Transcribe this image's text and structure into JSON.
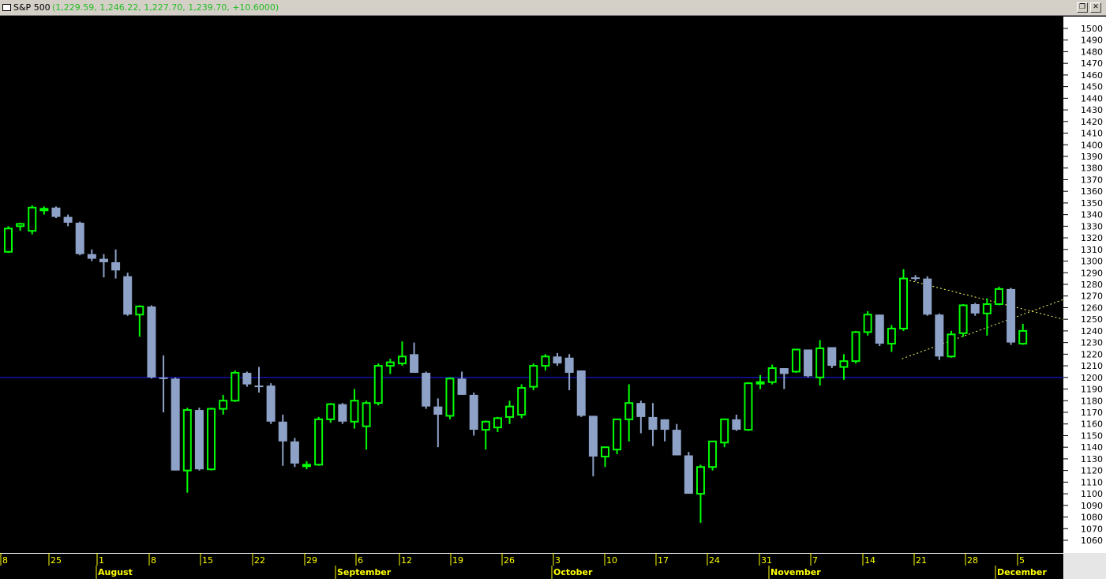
{
  "window": {
    "symbol": "S&P 500",
    "ohlc_readout": "(1,229.59, 1,246.22, 1,227.70, 1,239.70, +10.6000)",
    "restore_icon": "restore-window-icon",
    "close_icon": "close-window-icon",
    "restore_glyph": "❐",
    "close_glyph": "✕"
  },
  "colors": {
    "background": "#000000",
    "up_candle": "#00ff00",
    "down_candle": "#8ea2c8",
    "axis_text": "#ffff00",
    "horizontal_line": "#1a1aff",
    "trendline": "#ffff66"
  },
  "chart_data": {
    "type": "candlestick",
    "title": "S&P 500",
    "ylim": [
      1050,
      1510
    ],
    "y_ticks": [
      1060,
      1070,
      1080,
      1090,
      1100,
      1110,
      1120,
      1130,
      1140,
      1150,
      1160,
      1170,
      1180,
      1190,
      1200,
      1210,
      1220,
      1230,
      1240,
      1250,
      1260,
      1270,
      1280,
      1290,
      1300,
      1310,
      1320,
      1330,
      1340,
      1350,
      1360,
      1370,
      1380,
      1390,
      1400,
      1410,
      1420,
      1430,
      1440,
      1450,
      1460,
      1470,
      1480,
      1490,
      1500
    ],
    "x_day_ticks": [
      "8",
      "25",
      "1",
      "8",
      "15",
      "22",
      "29",
      "6",
      "12",
      "19",
      "26",
      "3",
      "10",
      "17",
      "24",
      "31",
      "7",
      "14",
      "21",
      "28",
      "5"
    ],
    "x_month_labels": [
      "August",
      "September",
      "October",
      "November",
      "December"
    ],
    "candles": [
      {
        "o": 1308,
        "h": 1330,
        "l": 1307,
        "c": 1328
      },
      {
        "o": 1330,
        "h": 1333,
        "l": 1326,
        "c": 1332
      },
      {
        "o": 1326,
        "h": 1348,
        "l": 1323,
        "c": 1346
      },
      {
        "o": 1344,
        "h": 1347,
        "l": 1340,
        "c": 1345
      },
      {
        "o": 1346,
        "h": 1347,
        "l": 1337,
        "c": 1338
      },
      {
        "o": 1338,
        "h": 1340,
        "l": 1330,
        "c": 1333
      },
      {
        "o": 1333,
        "h": 1334,
        "l": 1305,
        "c": 1306
      },
      {
        "o": 1306,
        "h": 1310,
        "l": 1300,
        "c": 1302
      },
      {
        "o": 1302,
        "h": 1306,
        "l": 1286,
        "c": 1299
      },
      {
        "o": 1299,
        "h": 1310,
        "l": 1285,
        "c": 1292
      },
      {
        "o": 1287,
        "h": 1290,
        "l": 1253,
        "c": 1254
      },
      {
        "o": 1254,
        "h": 1262,
        "l": 1235,
        "c": 1261
      },
      {
        "o": 1261,
        "h": 1262,
        "l": 1199,
        "c": 1200
      },
      {
        "o": 1200,
        "h": 1219,
        "l": 1170,
        "c": 1199
      },
      {
        "o": 1199,
        "h": 1200,
        "l": 1120,
        "c": 1120
      },
      {
        "o": 1120,
        "h": 1174,
        "l": 1101,
        "c": 1172
      },
      {
        "o": 1172,
        "h": 1174,
        "l": 1120,
        "c": 1121
      },
      {
        "o": 1121,
        "h": 1174,
        "l": 1120,
        "c": 1173
      },
      {
        "o": 1173,
        "h": 1185,
        "l": 1168,
        "c": 1180
      },
      {
        "o": 1180,
        "h": 1206,
        "l": 1179,
        "c": 1204
      },
      {
        "o": 1204,
        "h": 1205,
        "l": 1192,
        "c": 1194
      },
      {
        "o": 1193,
        "h": 1209,
        "l": 1187,
        "c": 1192
      },
      {
        "o": 1193,
        "h": 1195,
        "l": 1160,
        "c": 1162
      },
      {
        "o": 1162,
        "h": 1168,
        "l": 1124,
        "c": 1145
      },
      {
        "o": 1145,
        "h": 1148,
        "l": 1123,
        "c": 1126
      },
      {
        "o": 1124,
        "h": 1128,
        "l": 1121,
        "c": 1125
      },
      {
        "o": 1125,
        "h": 1166,
        "l": 1124,
        "c": 1164
      },
      {
        "o": 1164,
        "h": 1178,
        "l": 1161,
        "c": 1177
      },
      {
        "o": 1177,
        "h": 1178,
        "l": 1160,
        "c": 1162
      },
      {
        "o": 1162,
        "h": 1190,
        "l": 1156,
        "c": 1180
      },
      {
        "o": 1158,
        "h": 1180,
        "l": 1138,
        "c": 1178
      },
      {
        "o": 1178,
        "h": 1212,
        "l": 1176,
        "c": 1210
      },
      {
        "o": 1210,
        "h": 1216,
        "l": 1203,
        "c": 1213
      },
      {
        "o": 1212,
        "h": 1231,
        "l": 1210,
        "c": 1218
      },
      {
        "o": 1220,
        "h": 1230,
        "l": 1204,
        "c": 1204
      },
      {
        "o": 1204,
        "h": 1205,
        "l": 1173,
        "c": 1175
      },
      {
        "o": 1175,
        "h": 1182,
        "l": 1140,
        "c": 1168
      },
      {
        "o": 1167,
        "h": 1200,
        "l": 1164,
        "c": 1199
      },
      {
        "o": 1199,
        "h": 1205,
        "l": 1185,
        "c": 1185
      },
      {
        "o": 1185,
        "h": 1187,
        "l": 1150,
        "c": 1155
      },
      {
        "o": 1155,
        "h": 1163,
        "l": 1138,
        "c": 1162
      },
      {
        "o": 1157,
        "h": 1166,
        "l": 1153,
        "c": 1165
      },
      {
        "o": 1166,
        "h": 1180,
        "l": 1160,
        "c": 1175
      },
      {
        "o": 1168,
        "h": 1194,
        "l": 1165,
        "c": 1191
      },
      {
        "o": 1192,
        "h": 1212,
        "l": 1189,
        "c": 1210
      },
      {
        "o": 1210,
        "h": 1220,
        "l": 1206,
        "c": 1218
      },
      {
        "o": 1218,
        "h": 1221,
        "l": 1210,
        "c": 1212
      },
      {
        "o": 1217,
        "h": 1220,
        "l": 1189,
        "c": 1204
      },
      {
        "o": 1206,
        "h": 1206,
        "l": 1166,
        "c": 1167
      },
      {
        "o": 1167,
        "h": 1166,
        "l": 1115,
        "c": 1132
      },
      {
        "o": 1132,
        "h": 1140,
        "l": 1123,
        "c": 1140
      },
      {
        "o": 1138,
        "h": 1160,
        "l": 1134,
        "c": 1164
      },
      {
        "o": 1164,
        "h": 1194,
        "l": 1145,
        "c": 1178
      },
      {
        "o": 1178,
        "h": 1180,
        "l": 1152,
        "c": 1166
      },
      {
        "o": 1166,
        "h": 1178,
        "l": 1141,
        "c": 1155
      },
      {
        "o": 1164,
        "h": 1162,
        "l": 1145,
        "c": 1155
      },
      {
        "o": 1155,
        "h": 1160,
        "l": 1138,
        "c": 1133
      },
      {
        "o": 1133,
        "h": 1136,
        "l": 1100,
        "c": 1100
      },
      {
        "o": 1100,
        "h": 1125,
        "l": 1075,
        "c": 1123
      },
      {
        "o": 1123,
        "h": 1145,
        "l": 1120,
        "c": 1145
      },
      {
        "o": 1144,
        "h": 1163,
        "l": 1140,
        "c": 1164
      },
      {
        "o": 1164,
        "h": 1168,
        "l": 1154,
        "c": 1155
      },
      {
        "o": 1155,
        "h": 1196,
        "l": 1154,
        "c": 1195
      },
      {
        "o": 1195,
        "h": 1202,
        "l": 1190,
        "c": 1196
      },
      {
        "o": 1196,
        "h": 1211,
        "l": 1194,
        "c": 1208
      },
      {
        "o": 1208,
        "h": 1208,
        "l": 1190,
        "c": 1203
      },
      {
        "o": 1205,
        "h": 1224,
        "l": 1204,
        "c": 1224
      },
      {
        "o": 1224,
        "h": 1224,
        "l": 1200,
        "c": 1201
      },
      {
        "o": 1200,
        "h": 1232,
        "l": 1193,
        "c": 1225
      },
      {
        "o": 1226,
        "h": 1226,
        "l": 1208,
        "c": 1210
      },
      {
        "o": 1209,
        "h": 1220,
        "l": 1198,
        "c": 1214
      },
      {
        "o": 1214,
        "h": 1240,
        "l": 1212,
        "c": 1239
      },
      {
        "o": 1239,
        "h": 1257,
        "l": 1236,
        "c": 1254
      },
      {
        "o": 1254,
        "h": 1254,
        "l": 1227,
        "c": 1229
      },
      {
        "o": 1229,
        "h": 1245,
        "l": 1222,
        "c": 1242
      },
      {
        "o": 1242,
        "h": 1293,
        "l": 1240,
        "c": 1285
      },
      {
        "o": 1286,
        "h": 1288,
        "l": 1283,
        "c": 1285
      },
      {
        "o": 1285,
        "h": 1287,
        "l": 1253,
        "c": 1254
      },
      {
        "o": 1254,
        "h": 1255,
        "l": 1215,
        "c": 1218
      },
      {
        "o": 1218,
        "h": 1240,
        "l": 1217,
        "c": 1237
      },
      {
        "o": 1238,
        "h": 1263,
        "l": 1235,
        "c": 1262
      },
      {
        "o": 1263,
        "h": 1264,
        "l": 1253,
        "c": 1255
      },
      {
        "o": 1255,
        "h": 1268,
        "l": 1236,
        "c": 1263
      },
      {
        "o": 1263,
        "h": 1278,
        "l": 1262,
        "c": 1276
      },
      {
        "o": 1276,
        "h": 1277,
        "l": 1228,
        "c": 1230
      },
      {
        "o": 1229,
        "h": 1246,
        "l": 1228,
        "c": 1240
      }
    ],
    "horizontal_line": 1200,
    "trendlines": [
      {
        "x1": 0,
        "y1": 1285,
        "x2": 1,
        "y2": 1250
      },
      {
        "x1": 0,
        "y1": 1216,
        "x2": 1,
        "y2": 1267
      }
    ]
  }
}
